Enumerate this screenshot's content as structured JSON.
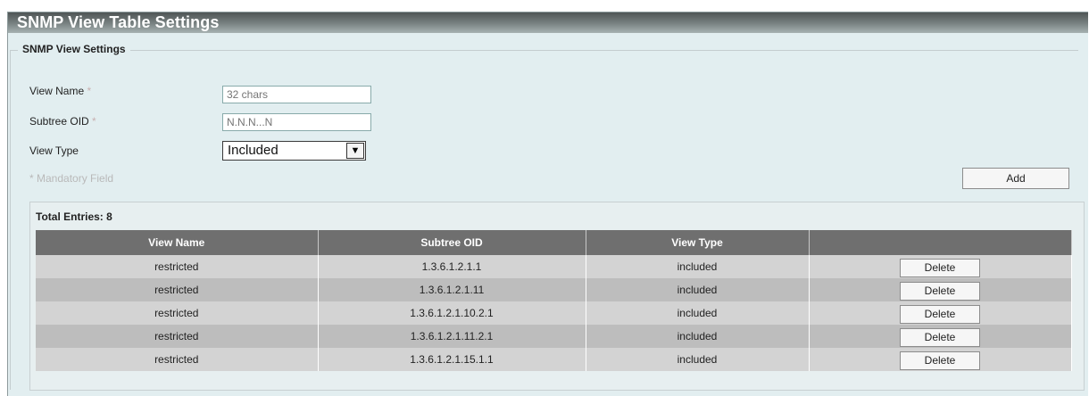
{
  "page": {
    "title": "SNMP View Table Settings"
  },
  "settings": {
    "legend": "SNMP View Settings",
    "view_name_label": "View Name",
    "subtree_oid_label": "Subtree OID",
    "view_type_label": "View Type",
    "required_marker": "*",
    "view_name_placeholder": "32 chars",
    "subtree_oid_placeholder": "N.N.N...N",
    "view_type_selected": "Included",
    "mandatory_note": "* Mandatory Field",
    "add_label": "Add"
  },
  "table": {
    "total_entries": "Total Entries: 8",
    "headers": [
      "View Name",
      "Subtree OID",
      "View Type",
      ""
    ],
    "delete_label": "Delete",
    "rows": [
      [
        "restricted",
        "1.3.6.1.2.1.1",
        "included"
      ],
      [
        "restricted",
        "1.3.6.1.2.1.11",
        "included"
      ],
      [
        "restricted",
        "1.3.6.1.2.1.10.2.1",
        "included"
      ],
      [
        "restricted",
        "1.3.6.1.2.1.11.2.1",
        "included"
      ],
      [
        "restricted",
        "1.3.6.1.2.1.15.1.1",
        "included"
      ]
    ]
  }
}
